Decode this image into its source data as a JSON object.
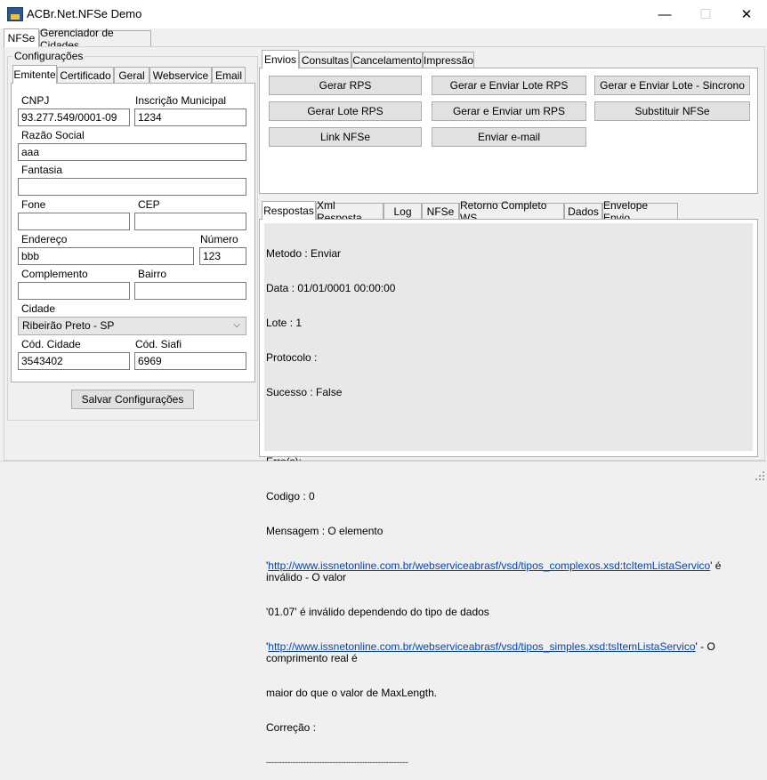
{
  "window": {
    "title": "ACBr.Net.NFSe Demo",
    "minimize": "—",
    "maximize": "☐",
    "close": "✕"
  },
  "main_tabs": [
    {
      "label": "NFSe"
    },
    {
      "label": "Gerenciador de Cidades"
    }
  ],
  "config": {
    "legend": "Configurações",
    "tabs": [
      {
        "label": "Emitente"
      },
      {
        "label": "Certificado"
      },
      {
        "label": "Geral"
      },
      {
        "label": "Webservice"
      },
      {
        "label": "Email"
      }
    ],
    "cnpj": {
      "label": "CNPJ",
      "value": "93.277.549/0001-09"
    },
    "inscricao": {
      "label": "Inscrição Municipal",
      "value": "1234"
    },
    "razao": {
      "label": "Razão Social",
      "value": "aaa"
    },
    "fantasia": {
      "label": "Fantasia",
      "value": ""
    },
    "fone": {
      "label": "Fone",
      "value": ""
    },
    "cep": {
      "label": "CEP",
      "value": ""
    },
    "endereco": {
      "label": "Endereço",
      "value": "bbb"
    },
    "numero": {
      "label": "Número",
      "value": "123"
    },
    "complemento": {
      "label": "Complemento",
      "value": ""
    },
    "bairro": {
      "label": "Bairro",
      "value": ""
    },
    "cidade": {
      "label": "Cidade",
      "value": "Ribeirão Preto - SP"
    },
    "cod_cidade": {
      "label": "Cód. Cidade",
      "value": "3543402"
    },
    "cod_siafi": {
      "label": "Cód. Siafi",
      "value": "6969"
    },
    "save_button": "Salvar Configurações"
  },
  "actions": {
    "tabs": [
      {
        "label": "Envios"
      },
      {
        "label": "Consultas"
      },
      {
        "label": "Cancelamento"
      },
      {
        "label": "Impressão"
      }
    ],
    "buttons": [
      "Gerar RPS",
      "Gerar e Enviar Lote RPS",
      "Gerar e Enviar Lote - Sincrono",
      "Gerar Lote RPS",
      "Gerar e Enviar um RPS",
      "Substituir NFSe",
      "Link NFSe",
      "Enviar e-mail"
    ]
  },
  "response": {
    "tabs": [
      {
        "label": "Respostas"
      },
      {
        "label": "Xml Resposta"
      },
      {
        "label": "Log"
      },
      {
        "label": "NFSe"
      },
      {
        "label": "Retorno Completo WS"
      },
      {
        "label": "Dados"
      },
      {
        "label": "Envelope Envio"
      }
    ],
    "lines": [
      "Metodo : Enviar",
      "Data : 01/01/0001 00:00:00",
      "Lote : 1",
      "Protocolo :",
      "Sucesso : False",
      "",
      "Erro(s):",
      "Codigo : 0",
      "Mensagem : O elemento"
    ],
    "msg_q1": "'",
    "msg_link1": "http://www.issnetonline.com.br/webserviceabrasf/vsd/tipos_complexos.xsd:tcItemListaServico",
    "msg_after1": "' é inválido - O valor",
    "msg_line2": "'01.07' é inválido dependendo do tipo de dados",
    "msg_q2": "'",
    "msg_link2": "http://www.issnetonline.com.br/webserviceabrasf/vsd/tipos_simples.xsd:tsItemListaServico",
    "msg_after2": "' - O comprimento real é",
    "msg_line3": "maior do que o valor de MaxLength.",
    "correcao": "Correção :",
    "separator": "----------------------------------------------------------------"
  }
}
